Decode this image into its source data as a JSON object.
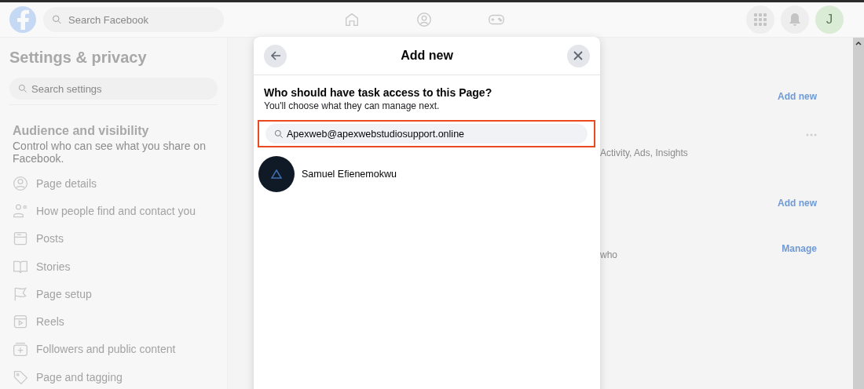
{
  "top_bar": {
    "search": {
      "placeholder": "Search Facebook"
    },
    "avatar_letter": "J"
  },
  "sidebar": {
    "title": "Settings & privacy",
    "search": {
      "placeholder": "Search settings"
    },
    "section_title": "Audience and visibility",
    "section_description": "Control who can see what you share on Facebook.",
    "items": [
      {
        "label": "Page details"
      },
      {
        "label": "How people find and contact you"
      },
      {
        "label": "Posts"
      },
      {
        "label": "Stories"
      },
      {
        "label": "Page setup"
      },
      {
        "label": "Reels"
      },
      {
        "label": "Followers and public content"
      },
      {
        "label": "Page and tagging"
      }
    ]
  },
  "background": {
    "rows": [
      {
        "kind": "action",
        "text": "Add new"
      },
      {
        "kind": "more",
        "text": "Activity, Ads, Insights"
      },
      {
        "kind": "action",
        "text": "Add new"
      },
      {
        "kind": "action",
        "text": "Manage",
        "note": "who"
      }
    ]
  },
  "modal": {
    "title": "Add new",
    "question": "Who should have task access to this Page?",
    "subtext": "You'll choose what they can manage next.",
    "search": {
      "value": "Apexweb@apexwebstudiosupport.online",
      "highlighted": true
    },
    "results": [
      {
        "name": "Samuel Efienemokwu"
      }
    ]
  }
}
